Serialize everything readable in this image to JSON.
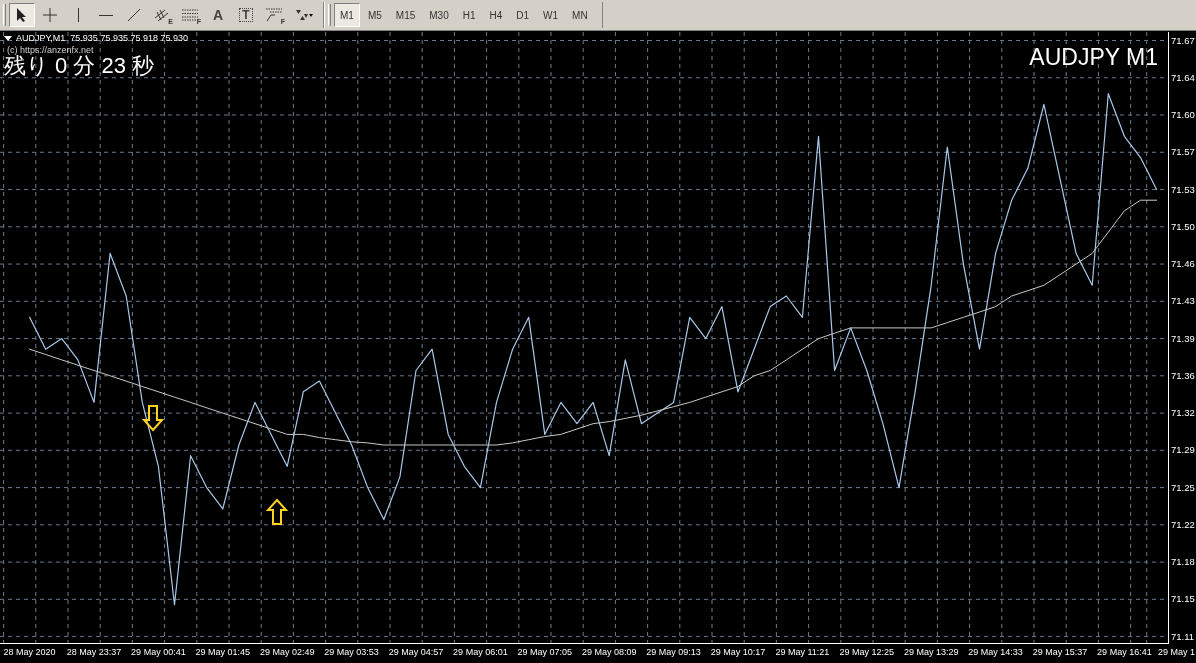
{
  "toolbar": {
    "tools": [
      {
        "kind": "cursor",
        "selected": true
      },
      {
        "kind": "crosshair",
        "selected": false
      },
      {
        "kind": "vline",
        "selected": false
      },
      {
        "kind": "hline",
        "selected": false
      },
      {
        "kind": "trendline",
        "selected": false
      },
      {
        "kind": "channel",
        "badge": "E",
        "selected": false
      },
      {
        "kind": "fibo",
        "badge": "F",
        "selected": false
      },
      {
        "kind": "text",
        "glyph": "A",
        "selected": false
      },
      {
        "kind": "label",
        "glyph": "T",
        "selected": false
      },
      {
        "kind": "fan",
        "badge": "F",
        "selected": false
      },
      {
        "kind": "arrows",
        "selected": false
      }
    ],
    "timeframes": [
      {
        "label": "M1",
        "selected": true
      },
      {
        "label": "M5",
        "selected": false
      },
      {
        "label": "M15",
        "selected": false
      },
      {
        "label": "M30",
        "selected": false
      },
      {
        "label": "H1",
        "selected": false
      },
      {
        "label": "H4",
        "selected": false
      },
      {
        "label": "D1",
        "selected": false
      },
      {
        "label": "W1",
        "selected": false
      },
      {
        "label": "MN",
        "selected": false
      }
    ]
  },
  "chart": {
    "symbol_info": "AUDJPY,M1  75.935 75.935 75.918 75.930",
    "copyright": "(c) https://anzenfx.net",
    "countdown": "残り 0 分 23 秒",
    "title": "AUDJPY M1",
    "chart_data": {
      "type": "line",
      "categories": [
        "28 May 2020",
        null,
        null,
        null,
        "28 May 23:37",
        null,
        null,
        null,
        "29 May 00:41",
        null,
        null,
        null,
        "29 May 01:45",
        null,
        null,
        null,
        "29 May 02:49",
        null,
        null,
        null,
        "29 May 03:53",
        null,
        null,
        null,
        "29 May 04:57",
        null,
        null,
        null,
        "29 May 06:01",
        null,
        null,
        null,
        "29 May 07:05",
        null,
        null,
        null,
        "29 May 08:09",
        null,
        null,
        null,
        "29 May 09:13",
        null,
        null,
        null,
        "29 May 10:17",
        null,
        null,
        null,
        "29 May 11:21",
        null,
        null,
        null,
        "29 May 12:25",
        null,
        null,
        null,
        "29 May 13:29",
        null,
        null,
        null,
        "29 May 14:33",
        null,
        null,
        null,
        "29 May 15:37",
        null,
        null,
        null,
        "29 May 16:41",
        null,
        null,
        "29 May 1"
      ],
      "series": [
        {
          "color": "#a9c8ea",
          "values": [
            71.41,
            71.38,
            71.39,
            71.37,
            71.33,
            71.47,
            71.43,
            71.33,
            71.27,
            71.14,
            71.28,
            71.25,
            71.23,
            71.29,
            71.33,
            71.3,
            71.27,
            71.34,
            71.35,
            71.32,
            71.29,
            71.25,
            71.22,
            71.26,
            71.36,
            71.38,
            71.3,
            71.27,
            71.25,
            71.33,
            71.38,
            71.41,
            71.3,
            71.33,
            71.31,
            71.33,
            71.28,
            71.37,
            71.31,
            71.32,
            71.33,
            71.41,
            71.39,
            71.42,
            71.34,
            71.38,
            71.42,
            71.43,
            71.41,
            71.58,
            71.36,
            71.4,
            71.36,
            71.31,
            71.25,
            71.34,
            71.44,
            71.57,
            71.46,
            71.38,
            71.47,
            71.52,
            71.55,
            71.61,
            71.54,
            71.47,
            71.44,
            71.62,
            71.58,
            71.56,
            71.53,
            null
          ]
        },
        {
          "color": "#c8c8c8",
          "values": [
            71.38,
            71.375,
            71.37,
            71.365,
            71.36,
            71.355,
            71.35,
            71.345,
            71.34,
            71.335,
            71.33,
            71.325,
            71.32,
            71.315,
            71.31,
            71.305,
            71.3,
            71.3,
            71.297,
            71.295,
            71.293,
            71.292,
            71.29,
            71.29,
            71.29,
            71.29,
            71.29,
            71.29,
            71.29,
            71.29,
            71.292,
            71.295,
            71.298,
            71.3,
            71.305,
            71.31,
            71.312,
            71.315,
            71.318,
            71.322,
            71.326,
            71.33,
            71.335,
            71.34,
            71.345,
            71.355,
            71.36,
            71.37,
            71.38,
            71.39,
            71.395,
            71.4,
            71.4,
            71.4,
            71.4,
            71.4,
            71.4,
            71.405,
            71.41,
            71.415,
            71.42,
            71.43,
            71.435,
            71.44,
            71.45,
            71.46,
            71.47,
            71.49,
            71.51,
            71.52,
            71.52,
            null
          ]
        }
      ],
      "grid": true,
      "ylim": [
        71.104,
        71.678
      ],
      "yticks": [
        {
          "value": 71.67,
          "label": "71.67"
        },
        {
          "value": 71.635,
          "label": "71.64"
        },
        {
          "value": 71.6,
          "label": "71.60"
        },
        {
          "value": 71.565,
          "label": "71.57"
        },
        {
          "value": 71.53,
          "label": "71.53"
        },
        {
          "value": 71.495,
          "label": "71.50"
        },
        {
          "value": 71.46,
          "label": "71.46"
        },
        {
          "value": 71.425,
          "label": "71.43"
        },
        {
          "value": 71.39,
          "label": "71.39"
        },
        {
          "value": 71.355,
          "label": "71.36"
        },
        {
          "value": 71.32,
          "label": "71.32"
        },
        {
          "value": 71.285,
          "label": "71.29"
        },
        {
          "value": 71.25,
          "label": "71.25"
        },
        {
          "value": 71.215,
          "label": "71.22"
        },
        {
          "value": 71.18,
          "label": "71.18"
        },
        {
          "value": 71.145,
          "label": "71.15"
        },
        {
          "value": 71.11,
          "label": "71.11"
        }
      ]
    },
    "markers": [
      {
        "kind": "arrow-down",
        "color": "#ffd21f"
      },
      {
        "kind": "arrow-up",
        "color": "#ffd21f"
      }
    ]
  }
}
